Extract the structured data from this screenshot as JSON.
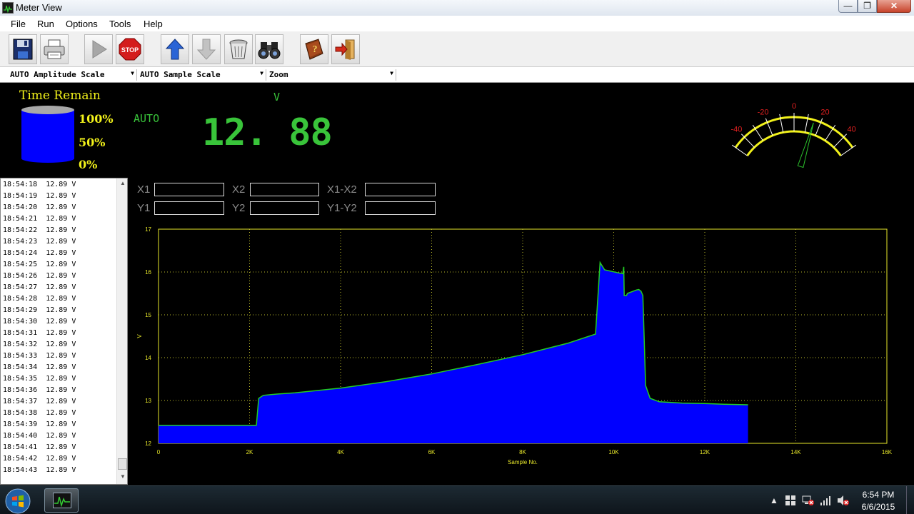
{
  "window": {
    "title": "Meter View"
  },
  "menu": [
    "File",
    "Run",
    "Options",
    "Tools",
    "Help"
  ],
  "toolbar": {
    "buttons": [
      "save-icon",
      "print-icon",
      "run-icon",
      "stop-icon",
      "upload-icon",
      "download-icon",
      "trash-icon",
      "binoculars-icon",
      "help-book-icon",
      "exit-icon"
    ],
    "stop_label": "STOP"
  },
  "scale": {
    "amplitude": "AUTO Amplitude Scale",
    "sample": "AUTO Sample Scale",
    "zoom": "Zoom"
  },
  "meter": {
    "time_remain_label": "Time Remain",
    "levels": [
      "100%",
      "50%",
      "0%"
    ],
    "range_mode": "AUTO",
    "unit": "V",
    "reading": "12. 88"
  },
  "gauge": {
    "ticks": [
      "-40",
      "-20",
      "0",
      "20",
      "40"
    ],
    "needle_value": 15,
    "range": [
      -50,
      50
    ]
  },
  "log": [
    {
      "time": "18:54:18",
      "value": "12.89 V"
    },
    {
      "time": "18:54:19",
      "value": "12.89 V"
    },
    {
      "time": "18:54:20",
      "value": "12.89 V"
    },
    {
      "time": "18:54:21",
      "value": "12.89 V"
    },
    {
      "time": "18:54:22",
      "value": "12.89 V"
    },
    {
      "time": "18:54:23",
      "value": "12.89 V"
    },
    {
      "time": "18:54:24",
      "value": "12.89 V"
    },
    {
      "time": "18:54:25",
      "value": "12.89 V"
    },
    {
      "time": "18:54:26",
      "value": "12.89 V"
    },
    {
      "time": "18:54:27",
      "value": "12.89 V"
    },
    {
      "time": "18:54:28",
      "value": "12.89 V"
    },
    {
      "time": "18:54:29",
      "value": "12.89 V"
    },
    {
      "time": "18:54:30",
      "value": "12.89 V"
    },
    {
      "time": "18:54:31",
      "value": "12.89 V"
    },
    {
      "time": "18:54:32",
      "value": "12.89 V"
    },
    {
      "time": "18:54:33",
      "value": "12.89 V"
    },
    {
      "time": "18:54:34",
      "value": "12.89 V"
    },
    {
      "time": "18:54:35",
      "value": "12.89 V"
    },
    {
      "time": "18:54:36",
      "value": "12.89 V"
    },
    {
      "time": "18:54:37",
      "value": "12.89 V"
    },
    {
      "time": "18:54:38",
      "value": "12.89 V"
    },
    {
      "time": "18:54:39",
      "value": "12.89 V"
    },
    {
      "time": "18:54:40",
      "value": "12.89 V"
    },
    {
      "time": "18:54:41",
      "value": "12.89 V"
    },
    {
      "time": "18:54:42",
      "value": "12.89 V"
    },
    {
      "time": "18:54:43",
      "value": "12.89 V"
    }
  ],
  "cursors": {
    "x1": "X1",
    "x2": "X2",
    "dx": "X1-X2",
    "y1": "Y1",
    "y2": "Y2",
    "dy": "Y1-Y2",
    "x1_value": "",
    "x2_value": "",
    "dx_value": "",
    "y1_value": "",
    "y2_value": "",
    "dy_value": ""
  },
  "chart_data": {
    "type": "area",
    "xlabel": "Sample No.",
    "ylabel": "V",
    "xlim": [
      0,
      16000
    ],
    "ylim": [
      12,
      17
    ],
    "xticks": [
      "0",
      "2K",
      "4K",
      "6K",
      "8K",
      "10K",
      "12K",
      "14K",
      "16K"
    ],
    "yticks": [
      "12",
      "13",
      "14",
      "15",
      "16",
      "17"
    ],
    "grid": true,
    "colors": {
      "fill": "#0000ff",
      "line": "#22cc22",
      "axes": "#e8e82a",
      "grid": "#bdbd2a"
    },
    "x": [
      0,
      500,
      1000,
      1500,
      2000,
      2150,
      2200,
      2300,
      2600,
      3000,
      4000,
      5000,
      6000,
      7000,
      8000,
      9000,
      9600,
      9700,
      9800,
      10100,
      10200,
      10220,
      10230,
      10280,
      10300,
      10500,
      10550,
      10600,
      10640,
      10700,
      10800,
      11000,
      11500,
      12000,
      12500,
      12950
    ],
    "y": [
      12.42,
      12.42,
      12.42,
      12.42,
      12.42,
      12.42,
      13.05,
      13.12,
      13.15,
      13.18,
      13.29,
      13.44,
      13.62,
      13.84,
      14.07,
      14.34,
      14.55,
      16.22,
      16.05,
      15.98,
      15.96,
      16.12,
      15.45,
      15.45,
      15.5,
      15.58,
      15.59,
      15.55,
      15.45,
      13.35,
      13.05,
      12.97,
      12.94,
      12.93,
      12.91,
      12.9
    ]
  },
  "taskbar": {
    "time": "6:54 PM",
    "date": "6/6/2015"
  }
}
